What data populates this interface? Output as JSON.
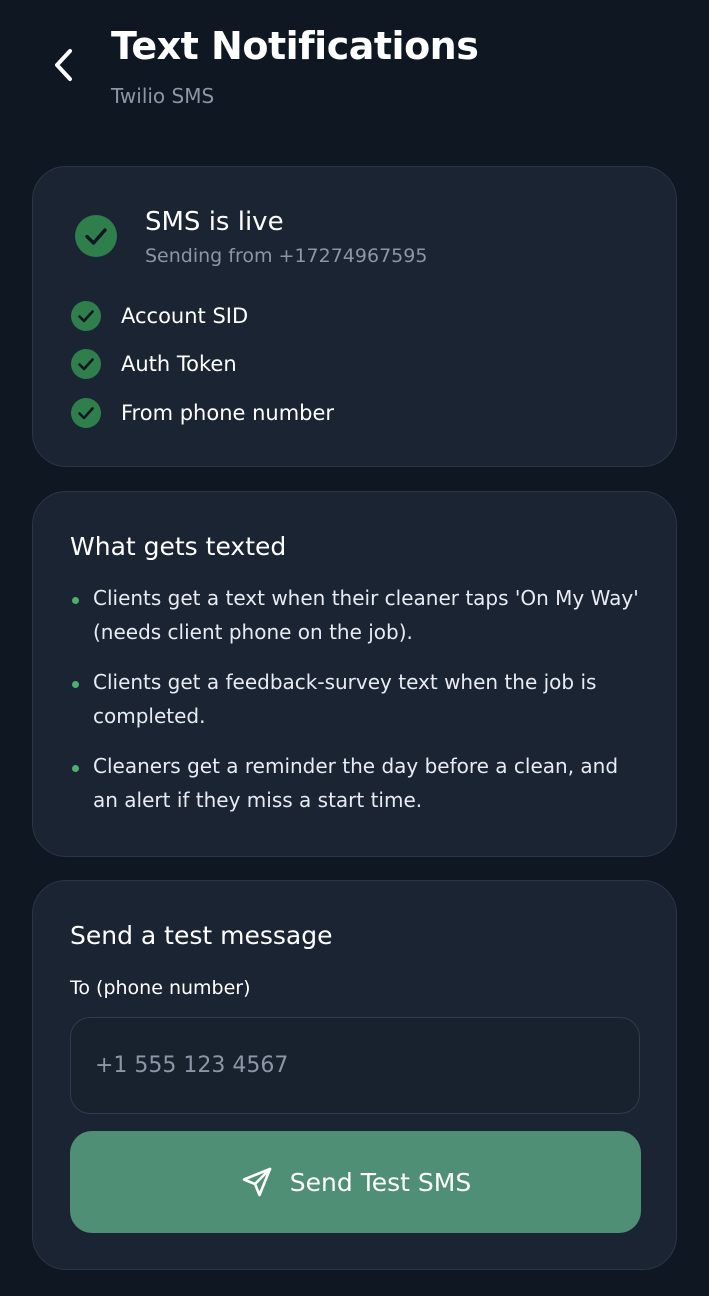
{
  "header": {
    "title": "Text Notifications",
    "subtitle": "Twilio SMS"
  },
  "status": {
    "title": "SMS is live",
    "subtitle": "Sending from +17274967595",
    "checks": [
      {
        "label": "Account SID"
      },
      {
        "label": "Auth Token"
      },
      {
        "label": "From phone number"
      }
    ]
  },
  "info": {
    "title": "What gets texted",
    "bullets": [
      "Clients get a text when their cleaner taps 'On My Way' (needs client phone on the job).",
      "Clients get a feedback-survey text when the job is completed.",
      "Cleaners get a reminder the day before a clean, and an alert if they miss a start time."
    ]
  },
  "test": {
    "title": "Send a test message",
    "field_label": "To (phone number)",
    "placeholder": "+1 555 123 4567",
    "value": "",
    "button_label": "Send Test SMS"
  },
  "icons": {
    "back": "chevron-left-icon",
    "status": "check-circle-icon",
    "check": "check-circle-icon",
    "send": "paper-plane-icon"
  },
  "colors": {
    "background": "#0f1722",
    "card": "#1a2433",
    "success": "#2f7f4d",
    "accent_button": "#4f8f75",
    "muted_text": "#8b96a6"
  }
}
